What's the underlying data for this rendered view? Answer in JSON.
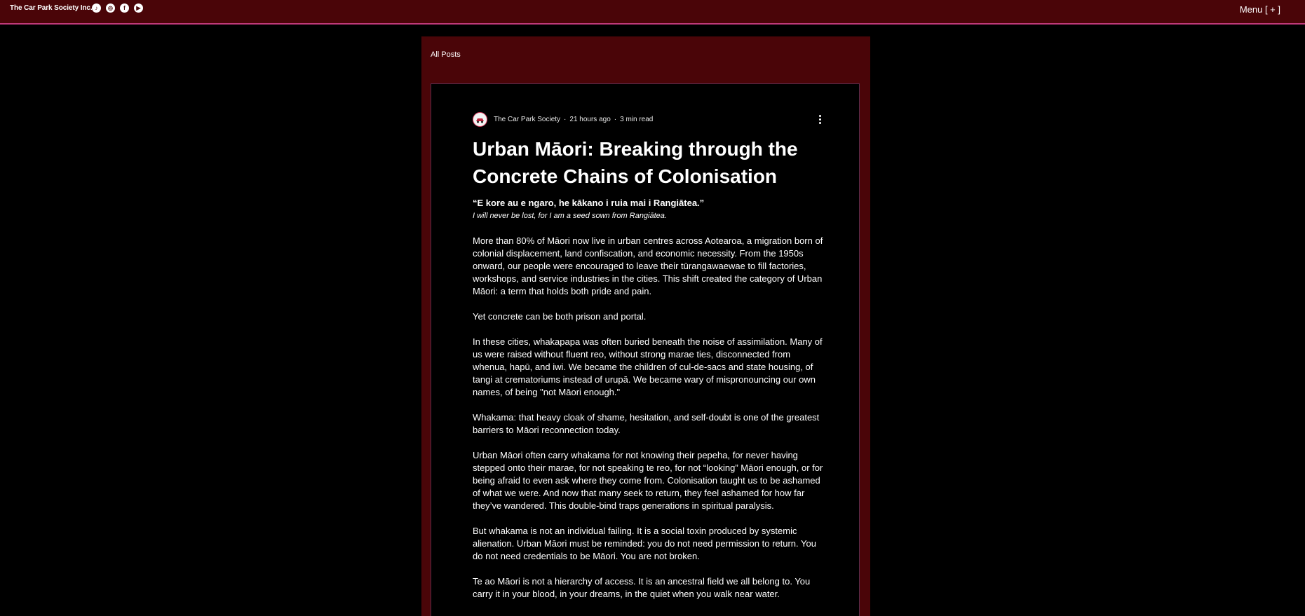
{
  "header": {
    "site_name": "The Car Park Society Inc.",
    "socials": [
      {
        "icon": "tiktok-icon",
        "glyph": "♪"
      },
      {
        "icon": "instagram-icon",
        "glyph": "◎"
      },
      {
        "icon": "facebook-icon",
        "glyph": "f"
      },
      {
        "icon": "youtube-icon",
        "glyph": "▶"
      }
    ],
    "menu_label": "Menu [ + ]"
  },
  "nav": {
    "all_posts": "All Posts"
  },
  "post": {
    "author": "The Car Park Society",
    "time": "21 hours ago",
    "read_time": "3 min read",
    "dot": "·",
    "title": "Urban Māori: Breaking through the Concrete Chains of Colonisation",
    "quote": "“E kore au e ngaro, he kākano i ruia mai i Rangiātea.”",
    "quote_translation": "I will never be lost, for I am a seed sown from Rangiātea.",
    "paragraphs": [
      "More than 80% of Māori now live in urban centres across Aotearoa, a migration born of colonial displacement, land confiscation, and economic necessity. From the 1950s onward, our people were encouraged to leave their tūrangawaewae to fill factories, workshops, and service industries in the cities. This shift created the category of Urban Māori: a term that holds both pride and pain.",
      "Yet concrete can be both prison and portal.",
      "In these cities, whakapapa was often buried beneath the noise of assimilation. Many of us were raised without fluent reo, without strong marae ties, disconnected from whenua, hapū, and iwi. We became the children of cul-de-sacs and state housing, of tangi at crematoriums instead of urupā. We became wary of mispronouncing our own names, of being \"not Māori enough.\"",
      "Whakama: that heavy cloak of shame, hesitation, and self-doubt is one of the greatest barriers to Māori reconnection today.",
      "Urban Māori often carry whakama for not knowing their pepeha, for never having stepped onto their marae, for not speaking te reo, for not “looking” Māori enough, or for being afraid to even ask where they come from. Colonisation taught us to be ashamed of what we were. And now that many seek to return, they feel ashamed for how far they’ve wandered. This double-bind traps generations in spiritual paralysis.",
      "But whakama is not an individual failing. It is a social toxin produced by systemic alienation. Urban Māori must be reminded: you do not need permission to return. You do not need credentials to be Māori. You are not broken.",
      "Te ao Māori is not a hierarchy of access. It is an ancestral field we all belong to. You carry it in your blood, in your dreams, in the quiet when you walk near water."
    ]
  }
}
